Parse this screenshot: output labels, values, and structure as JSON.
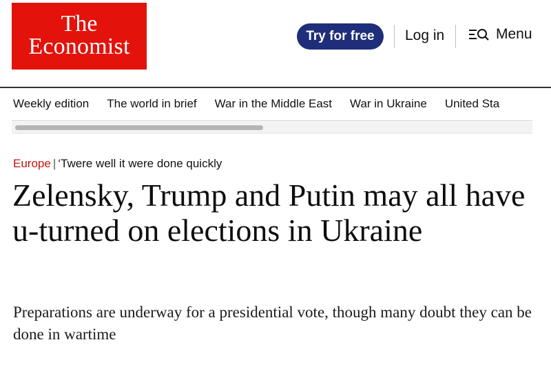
{
  "header": {
    "logo_line1": "The",
    "logo_line2": "Economist",
    "try_label": "Try for free",
    "login_label": "Log in",
    "menu_label": "Menu"
  },
  "nav": {
    "items": [
      "Weekly edition",
      "The world in brief",
      "War in the Middle East",
      "War in Ukraine",
      "United Sta"
    ]
  },
  "article": {
    "section": "Europe",
    "separator": "|",
    "rubric": "‘Twere well it were done quickly",
    "headline": "Zelensky, Trump and Putin may all have u-turned on elections in Ukraine",
    "standfirst": "Preparations are underway for a presidential vote, though many doubt they can be done in wartime"
  },
  "colors": {
    "brand_red": "#e3120b",
    "button_navy": "#1f2e7a",
    "section_red": "#c5140b"
  },
  "icons": {
    "menu": "menu-search-icon"
  }
}
